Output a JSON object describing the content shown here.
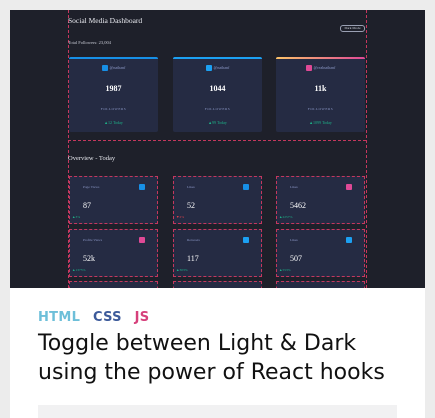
{
  "colors": {
    "page_background": "#ececec",
    "card_background": "#ffffff",
    "dashboard_background": "#1e202a",
    "card_dark": "#252b43",
    "guide_lines": "#c5375e",
    "positive": "#1db489",
    "facebook": "#178fe6",
    "twitter": "#1ca0f2",
    "instagram": "#df4996",
    "youtube": "#c4032a",
    "tag_html": "#6dbfd9",
    "tag_css": "#3c5a9a",
    "tag_js": "#d6407b"
  },
  "dashboard": {
    "title": "Social Media Dashboard",
    "subtitle": "Total Followers: 23,004",
    "toggle_label": "Dark Mode",
    "followers": [
      {
        "network": "facebook",
        "icon": "facebook-icon",
        "handle": "@nathanf",
        "count": "1987",
        "label": "FOLLOWERS",
        "delta": "▲12 Today"
      },
      {
        "network": "twitter",
        "icon": "twitter-icon",
        "handle": "@nathanf",
        "count": "1044",
        "label": "FOLLOWERS",
        "delta": "▲99 Today"
      },
      {
        "network": "instagram",
        "icon": "instagram-icon",
        "handle": "@realnathanf",
        "count": "11k",
        "label": "FOLLOWERS",
        "delta": "▲1099 Today"
      }
    ],
    "overview_title": "Overview - Today",
    "stats": [
      {
        "metric": "Page Views",
        "icon": "facebook-icon",
        "network": "facebook",
        "value": "87",
        "pct": "▲3%"
      },
      {
        "metric": "Likes",
        "icon": "facebook-icon",
        "network": "facebook",
        "value": "52",
        "pct": "▼2%"
      },
      {
        "metric": "Likes",
        "icon": "instagram-icon",
        "network": "instagram",
        "value": "5462",
        "pct": "▲2257%"
      },
      {
        "metric": "Profile Views",
        "icon": "instagram-icon",
        "network": "instagram",
        "value": "52k",
        "pct": "▲1375%"
      },
      {
        "metric": "Retweets",
        "icon": "twitter-icon",
        "network": "twitter",
        "value": "117",
        "pct": "▲303%"
      },
      {
        "metric": "Likes",
        "icon": "twitter-icon",
        "network": "twitter",
        "value": "507",
        "pct": "▲553%"
      }
    ]
  },
  "tags": {
    "html": "HTML",
    "css": "CSS",
    "js": "JS"
  },
  "headline": "Toggle between Light & Dark using the power of React hooks"
}
